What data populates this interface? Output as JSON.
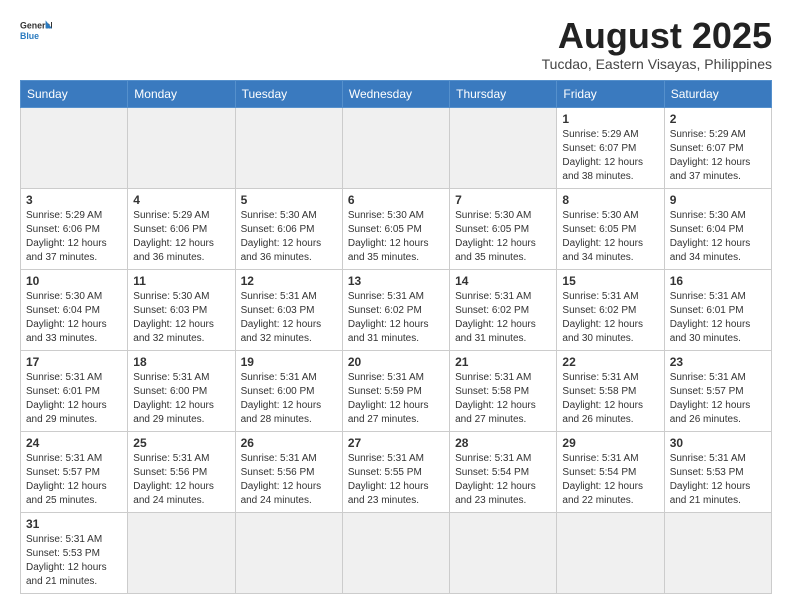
{
  "header": {
    "logo_general": "General",
    "logo_blue": "Blue",
    "month_title": "August 2025",
    "location": "Tucdao, Eastern Visayas, Philippines"
  },
  "weekdays": [
    "Sunday",
    "Monday",
    "Tuesday",
    "Wednesday",
    "Thursday",
    "Friday",
    "Saturday"
  ],
  "weeks": [
    [
      {
        "day": "",
        "empty": true
      },
      {
        "day": "",
        "empty": true
      },
      {
        "day": "",
        "empty": true
      },
      {
        "day": "",
        "empty": true
      },
      {
        "day": "",
        "empty": true
      },
      {
        "day": "1",
        "sunrise": "5:29 AM",
        "sunset": "6:07 PM",
        "daylight": "12 hours and 38 minutes."
      },
      {
        "day": "2",
        "sunrise": "5:29 AM",
        "sunset": "6:07 PM",
        "daylight": "12 hours and 37 minutes."
      }
    ],
    [
      {
        "day": "3",
        "sunrise": "5:29 AM",
        "sunset": "6:06 PM",
        "daylight": "12 hours and 37 minutes."
      },
      {
        "day": "4",
        "sunrise": "5:29 AM",
        "sunset": "6:06 PM",
        "daylight": "12 hours and 36 minutes."
      },
      {
        "day": "5",
        "sunrise": "5:30 AM",
        "sunset": "6:06 PM",
        "daylight": "12 hours and 36 minutes."
      },
      {
        "day": "6",
        "sunrise": "5:30 AM",
        "sunset": "6:05 PM",
        "daylight": "12 hours and 35 minutes."
      },
      {
        "day": "7",
        "sunrise": "5:30 AM",
        "sunset": "6:05 PM",
        "daylight": "12 hours and 35 minutes."
      },
      {
        "day": "8",
        "sunrise": "5:30 AM",
        "sunset": "6:05 PM",
        "daylight": "12 hours and 34 minutes."
      },
      {
        "day": "9",
        "sunrise": "5:30 AM",
        "sunset": "6:04 PM",
        "daylight": "12 hours and 34 minutes."
      }
    ],
    [
      {
        "day": "10",
        "sunrise": "5:30 AM",
        "sunset": "6:04 PM",
        "daylight": "12 hours and 33 minutes."
      },
      {
        "day": "11",
        "sunrise": "5:30 AM",
        "sunset": "6:03 PM",
        "daylight": "12 hours and 32 minutes."
      },
      {
        "day": "12",
        "sunrise": "5:31 AM",
        "sunset": "6:03 PM",
        "daylight": "12 hours and 32 minutes."
      },
      {
        "day": "13",
        "sunrise": "5:31 AM",
        "sunset": "6:02 PM",
        "daylight": "12 hours and 31 minutes."
      },
      {
        "day": "14",
        "sunrise": "5:31 AM",
        "sunset": "6:02 PM",
        "daylight": "12 hours and 31 minutes."
      },
      {
        "day": "15",
        "sunrise": "5:31 AM",
        "sunset": "6:02 PM",
        "daylight": "12 hours and 30 minutes."
      },
      {
        "day": "16",
        "sunrise": "5:31 AM",
        "sunset": "6:01 PM",
        "daylight": "12 hours and 30 minutes."
      }
    ],
    [
      {
        "day": "17",
        "sunrise": "5:31 AM",
        "sunset": "6:01 PM",
        "daylight": "12 hours and 29 minutes."
      },
      {
        "day": "18",
        "sunrise": "5:31 AM",
        "sunset": "6:00 PM",
        "daylight": "12 hours and 29 minutes."
      },
      {
        "day": "19",
        "sunrise": "5:31 AM",
        "sunset": "6:00 PM",
        "daylight": "12 hours and 28 minutes."
      },
      {
        "day": "20",
        "sunrise": "5:31 AM",
        "sunset": "5:59 PM",
        "daylight": "12 hours and 27 minutes."
      },
      {
        "day": "21",
        "sunrise": "5:31 AM",
        "sunset": "5:58 PM",
        "daylight": "12 hours and 27 minutes."
      },
      {
        "day": "22",
        "sunrise": "5:31 AM",
        "sunset": "5:58 PM",
        "daylight": "12 hours and 26 minutes."
      },
      {
        "day": "23",
        "sunrise": "5:31 AM",
        "sunset": "5:57 PM",
        "daylight": "12 hours and 26 minutes."
      }
    ],
    [
      {
        "day": "24",
        "sunrise": "5:31 AM",
        "sunset": "5:57 PM",
        "daylight": "12 hours and 25 minutes."
      },
      {
        "day": "25",
        "sunrise": "5:31 AM",
        "sunset": "5:56 PM",
        "daylight": "12 hours and 24 minutes."
      },
      {
        "day": "26",
        "sunrise": "5:31 AM",
        "sunset": "5:56 PM",
        "daylight": "12 hours and 24 minutes."
      },
      {
        "day": "27",
        "sunrise": "5:31 AM",
        "sunset": "5:55 PM",
        "daylight": "12 hours and 23 minutes."
      },
      {
        "day": "28",
        "sunrise": "5:31 AM",
        "sunset": "5:54 PM",
        "daylight": "12 hours and 23 minutes."
      },
      {
        "day": "29",
        "sunrise": "5:31 AM",
        "sunset": "5:54 PM",
        "daylight": "12 hours and 22 minutes."
      },
      {
        "day": "30",
        "sunrise": "5:31 AM",
        "sunset": "5:53 PM",
        "daylight": "12 hours and 21 minutes."
      }
    ],
    [
      {
        "day": "31",
        "sunrise": "5:31 AM",
        "sunset": "5:53 PM",
        "daylight": "12 hours and 21 minutes."
      },
      {
        "day": "",
        "empty": true
      },
      {
        "day": "",
        "empty": true
      },
      {
        "day": "",
        "empty": true
      },
      {
        "day": "",
        "empty": true
      },
      {
        "day": "",
        "empty": true
      },
      {
        "day": "",
        "empty": true
      }
    ]
  ]
}
